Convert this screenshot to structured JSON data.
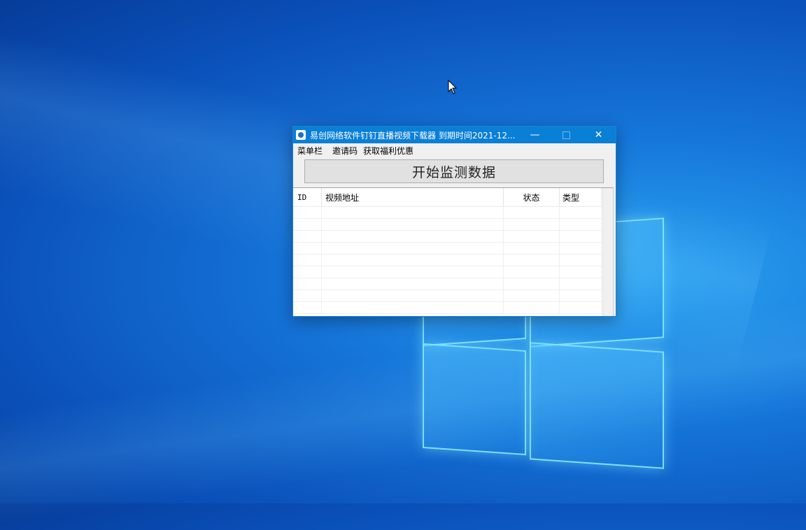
{
  "window": {
    "title": "易创网络软件钉钉直播视频下载器    到期时间2021-12...",
    "minimize_symbol": "—",
    "close_symbol": "✕"
  },
  "menu": {
    "items": [
      {
        "label": "菜单栏"
      },
      {
        "label": "邀请码"
      },
      {
        "label": "获取福利优惠"
      }
    ]
  },
  "main": {
    "start_button_label": "开始监测数据"
  },
  "table": {
    "columns": [
      "ID",
      "视频地址",
      "状态",
      "类型"
    ],
    "rows": []
  },
  "colors": {
    "titlebar": "#0a7fd6",
    "desktop": "#1677db"
  },
  "icons": [
    "app-icon",
    "minimize-icon",
    "maximize-icon",
    "close-icon",
    "mouse-cursor-icon"
  ]
}
